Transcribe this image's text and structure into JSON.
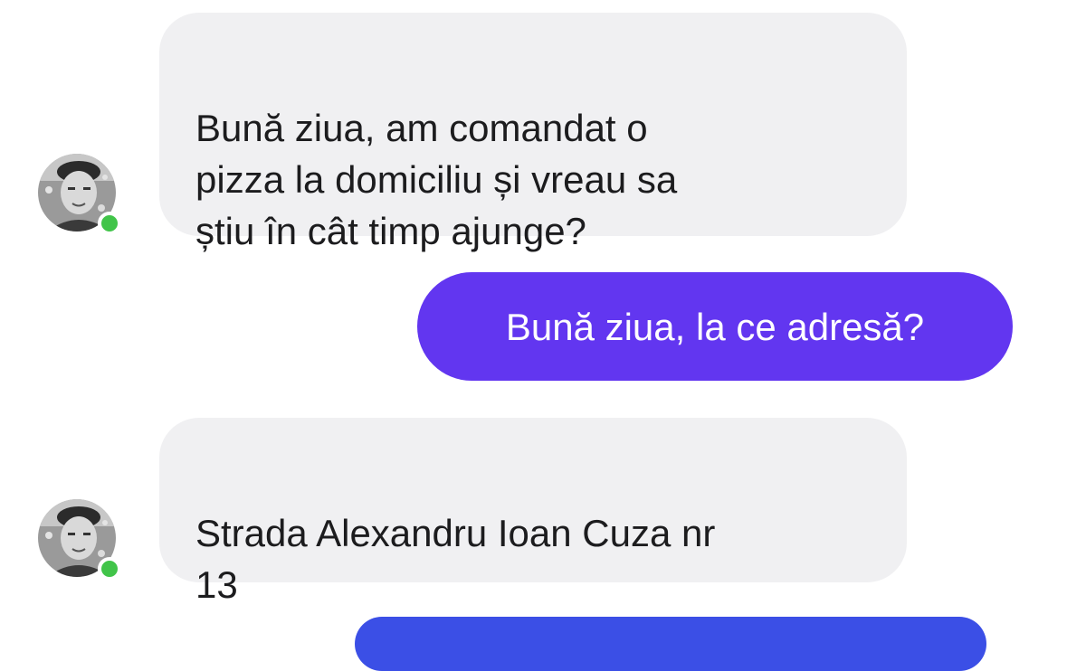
{
  "conversation": {
    "messages": [
      {
        "direction": "incoming",
        "text": "Bună ziua, am comandat o\npizza la domiciliu și vreau sa\nștiu în cât timp ajunge?"
      },
      {
        "direction": "outgoing",
        "text": "Bună ziua, la ce adresă?"
      },
      {
        "direction": "incoming",
        "text": "Strada Alexandru Ioan Cuza nr\n13"
      },
      {
        "direction": "outgoing",
        "text": ""
      }
    ]
  },
  "contact": {
    "avatar_icon": "user-avatar-photo",
    "status": "online",
    "status_color": "#41c449"
  },
  "colors": {
    "incoming_bubble": "#f0f0f2",
    "outgoing_bubble": "#6236f0",
    "background": "#ffffff"
  }
}
